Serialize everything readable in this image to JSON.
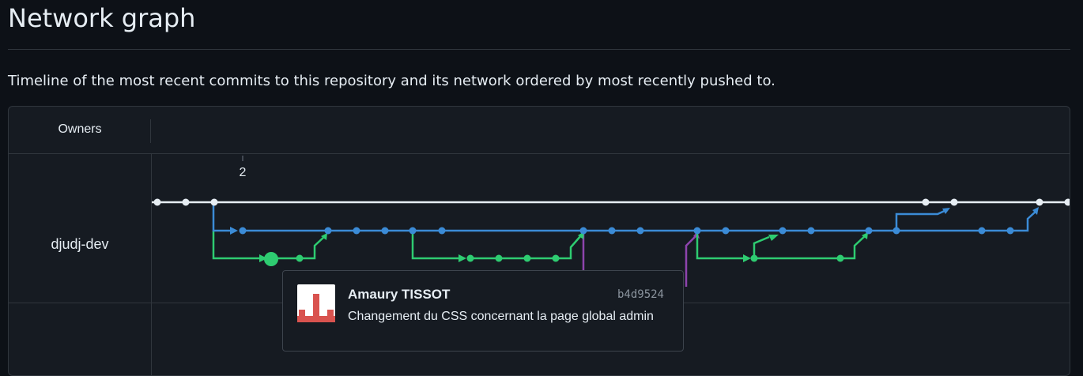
{
  "page": {
    "title": "Network graph",
    "subtitle": "Timeline of the most recent commits to this repository and its network ordered by most recently pushed to."
  },
  "graph": {
    "owners_header": "Owners",
    "owners": [
      "djudj-dev"
    ],
    "date_marker": "2",
    "colors": {
      "main": "#e6edf3",
      "blue": "#3b8bd6",
      "green": "#2ecc71",
      "purple": "#8e44ad"
    }
  },
  "tooltip": {
    "author": "Amaury TISSOT",
    "sha": "b4d9524",
    "message": "Changement du CSS concernant la page global admin",
    "avatar_icon": "identicon"
  }
}
